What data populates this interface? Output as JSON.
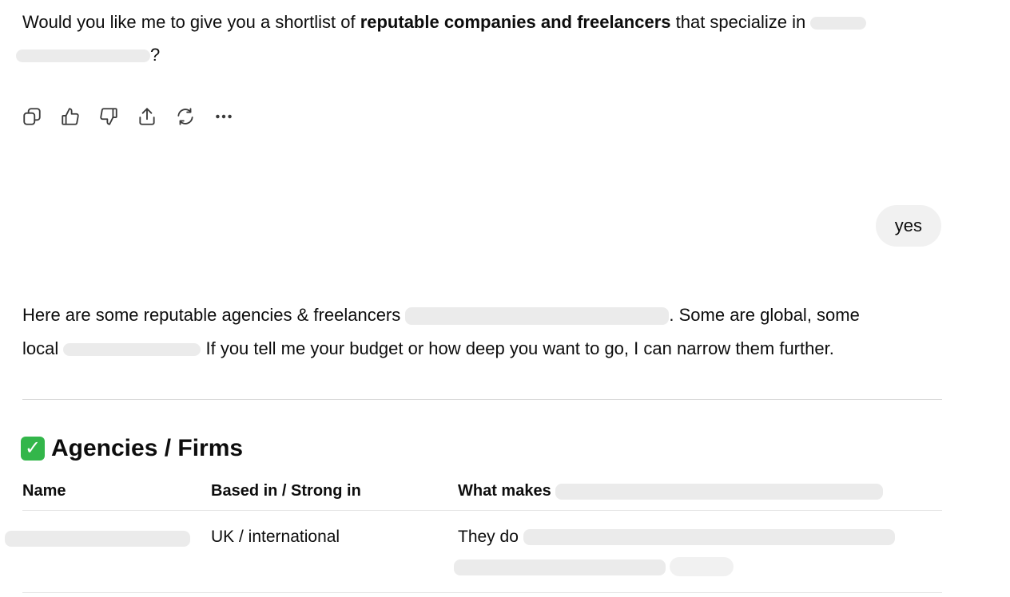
{
  "assistant_msg_1": {
    "prefix": "Would you like me to give you a shortlist of ",
    "bold": "reputable companies and freelancers",
    "suffix": " that specialize in",
    "line2_end": "?"
  },
  "actions": [
    {
      "icon": "copy-icon"
    },
    {
      "icon": "thumbs-up-icon"
    },
    {
      "icon": "thumbs-down-icon"
    },
    {
      "icon": "share-icon"
    },
    {
      "icon": "regenerate-icon"
    },
    {
      "icon": "more-icon"
    }
  ],
  "user_msg": {
    "text": "yes"
  },
  "assistant_msg_2": {
    "line1_start": "Here are some reputable agencies & freelancers",
    "line1_end": ". Some are global, some",
    "line2_start": "local",
    "line2_end": " If you tell me your budget or how deep you want to go, I can narrow them further."
  },
  "section": {
    "emoji": "✓",
    "title": "Agencies / Firms"
  },
  "table": {
    "headers": [
      "Name",
      "Based in / Strong in",
      "What makes"
    ],
    "rows": [
      {
        "based": "UK / international",
        "what_prefix": "They do"
      }
    ]
  }
}
